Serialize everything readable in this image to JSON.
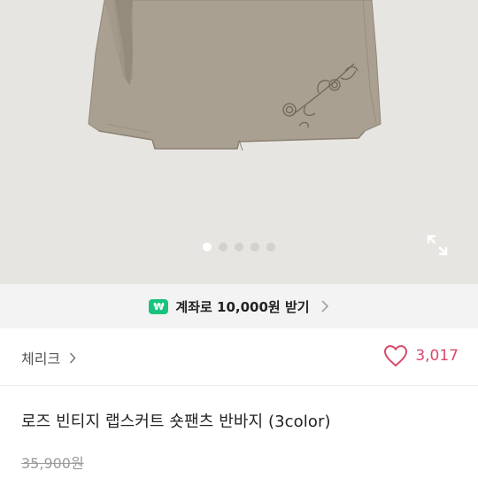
{
  "gallery": {
    "dots_total": 5,
    "dots_active_index": 0,
    "background": "#e7e5e1",
    "product_color": "#a99f90",
    "expand_icon": "expand-arrows-icon"
  },
  "promo": {
    "badge_text": "₩",
    "text": "계좌로 10,000원 받기",
    "badge_color": "#19c37d",
    "arrow_icon": "chevron-right-icon"
  },
  "shop": {
    "name": "체리크",
    "arrow_icon": "chevron-right-icon"
  },
  "likes": {
    "count": "3,017",
    "icon": "heart-outline-icon",
    "color": "#d94a6a"
  },
  "product": {
    "title": "로즈 빈티지 랩스커트 숏팬츠 반바지 (3color)",
    "original_price": "35,900원"
  }
}
